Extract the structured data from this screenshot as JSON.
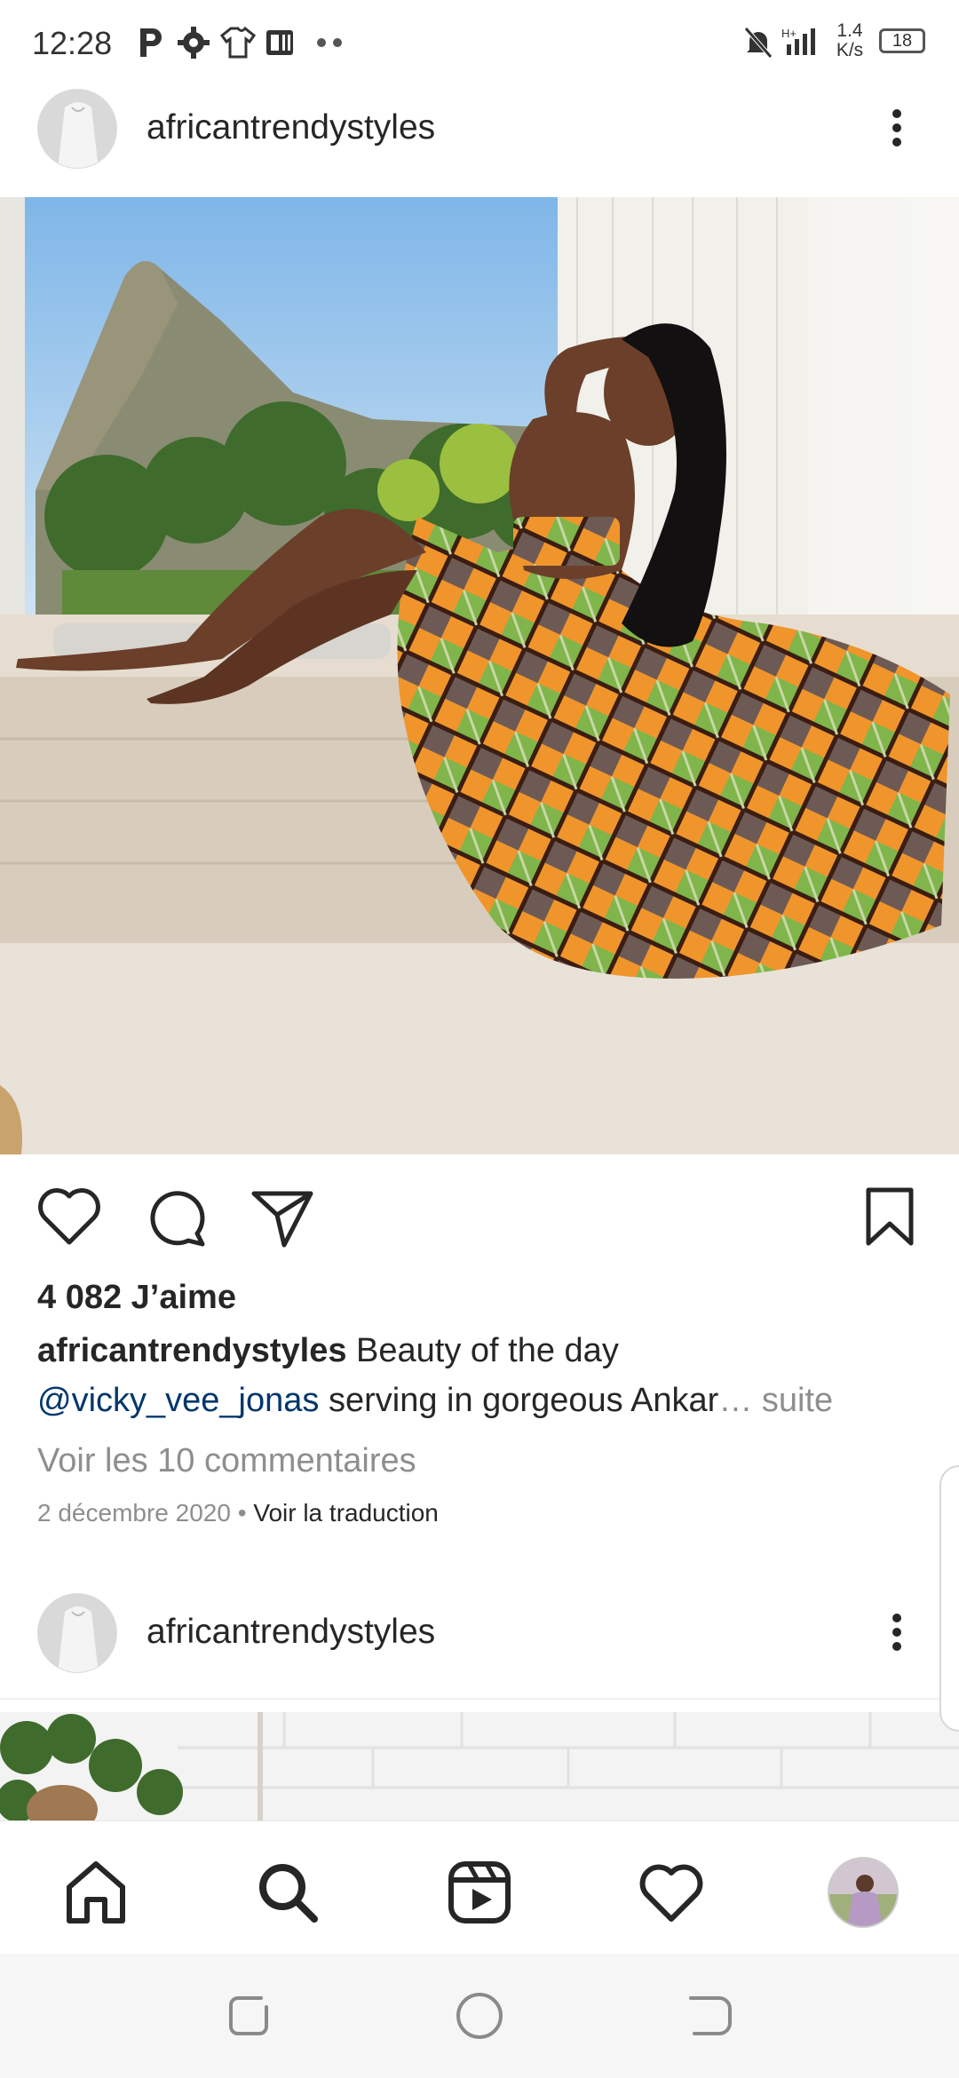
{
  "status_bar": {
    "time": "12:28",
    "network_speed_value": "1.4",
    "network_speed_unit": "K/s",
    "battery": "18",
    "icons": [
      "parking-icon",
      "gear-icon",
      "shirt-icon",
      "news-icon",
      "dots-icon",
      "bell-muted-icon",
      "signal-icon",
      "battery-icon"
    ]
  },
  "post": {
    "username": "africantrendystyles",
    "likes": "4 082 J’aime",
    "caption_user": "africantrendystyles",
    "caption_text": " Beauty of the day",
    "mention": "@vicky_vee_jonas",
    "caption_rest": "  serving in gorgeous Ankar",
    "ellipsis": "…",
    "more_label": " suite",
    "view_comments": "Voir les 10 commentaires",
    "date": "2 décembre 2020",
    "separator": " • ",
    "translate": "Voir la traduction"
  },
  "next_post": {
    "username": "africantrendystyles"
  },
  "bottom_nav": [
    "home-icon",
    "search-icon",
    "reels-icon",
    "heart-icon",
    "profile-avatar"
  ],
  "android_nav": [
    "recents-button",
    "home-button",
    "back-button"
  ],
  "colors": {
    "text": "#262626",
    "secondary": "#8e8e8e",
    "mention": "#00376b"
  }
}
